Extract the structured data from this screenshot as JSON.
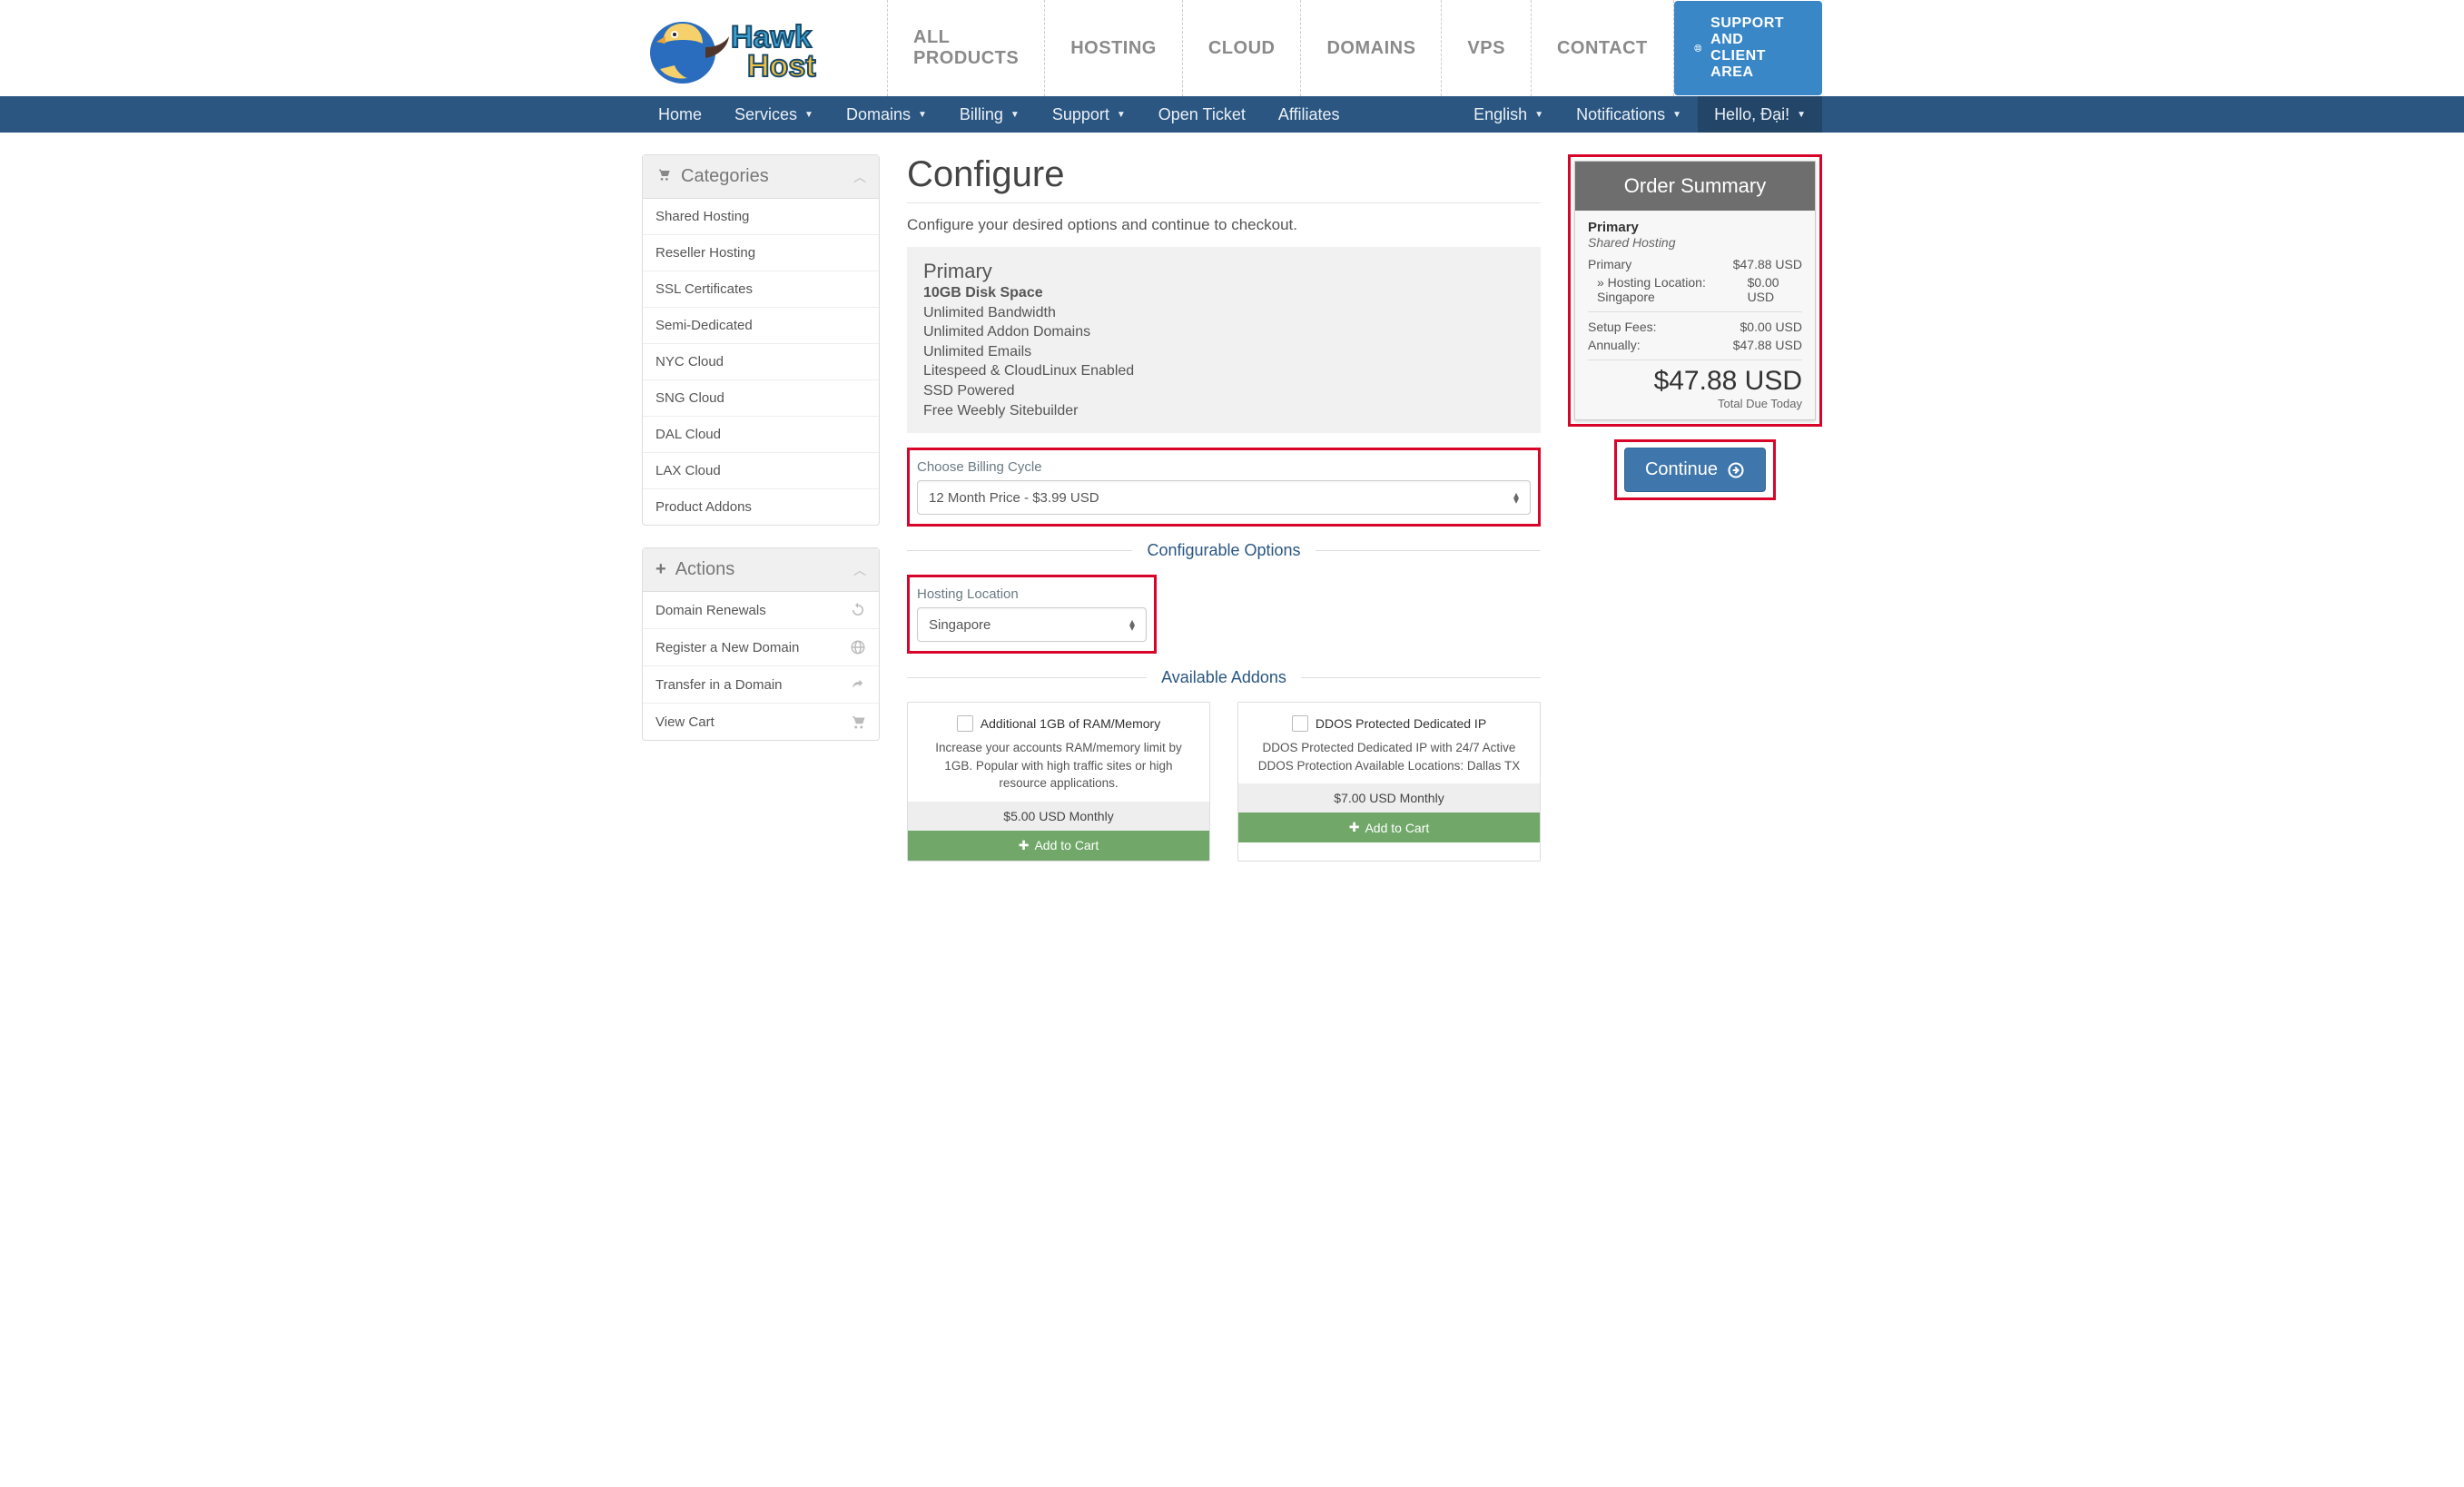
{
  "topnav": {
    "items": [
      "ALL PRODUCTS",
      "HOSTING",
      "CLOUD",
      "DOMAINS",
      "VPS",
      "CONTACT"
    ],
    "support_btn": "SUPPORT AND CLIENT AREA"
  },
  "subnav": {
    "left": [
      "Home",
      "Services",
      "Domains",
      "Billing",
      "Support",
      "Open Ticket",
      "Affiliates"
    ],
    "right": [
      "English",
      "Notifications",
      "Hello, Đại!"
    ]
  },
  "sidebar": {
    "categories": {
      "title": "Categories",
      "items": [
        "Shared Hosting",
        "Reseller Hosting",
        "SSL Certificates",
        "Semi-Dedicated",
        "NYC Cloud",
        "SNG Cloud",
        "DAL Cloud",
        "LAX Cloud",
        "Product Addons"
      ]
    },
    "actions": {
      "title": "Actions",
      "items": [
        "Domain Renewals",
        "Register a New Domain",
        "Transfer in a Domain",
        "View Cart"
      ]
    }
  },
  "page": {
    "title": "Configure",
    "subtitle": "Configure your desired options and continue to checkout."
  },
  "product": {
    "name": "Primary",
    "features": [
      "10GB Disk Space",
      "Unlimited Bandwidth",
      "Unlimited Addon Domains",
      "Unlimited Emails",
      "Litespeed & CloudLinux Enabled",
      "SSD Powered",
      "Free Weebly Sitebuilder"
    ]
  },
  "billing": {
    "label": "Choose Billing Cycle",
    "selected": "12 Month Price - $3.99 USD"
  },
  "sections": {
    "config_options": "Configurable Options",
    "addons_title": "Available Addons"
  },
  "location": {
    "label": "Hosting Location",
    "selected": "Singapore"
  },
  "addons": [
    {
      "title": "Additional 1GB of RAM/Memory",
      "desc": "Increase your accounts RAM/memory limit by 1GB. Popular with high traffic sites or high resource applications.",
      "price": "$5.00 USD Monthly",
      "btn": "Add to Cart"
    },
    {
      "title": "DDOS Protected Dedicated IP",
      "desc": "DDOS Protected Dedicated IP with 24/7 Active DDOS Protection Available Locations: Dallas TX",
      "price": "$7.00 USD Monthly",
      "btn": "Add to Cart"
    }
  ],
  "order": {
    "title": "Order Summary",
    "pname": "Primary",
    "ptype": "Shared Hosting",
    "lines": [
      {
        "label": "Primary",
        "value": "$47.88 USD"
      },
      {
        "label": "» Hosting Location: Singapore",
        "value": "$0.00 USD"
      }
    ],
    "fees": [
      {
        "label": "Setup Fees:",
        "value": "$0.00 USD"
      },
      {
        "label": "Annually:",
        "value": "$47.88 USD"
      }
    ],
    "total": "$47.88 USD",
    "due_label": "Total Due Today",
    "continue": "Continue"
  }
}
